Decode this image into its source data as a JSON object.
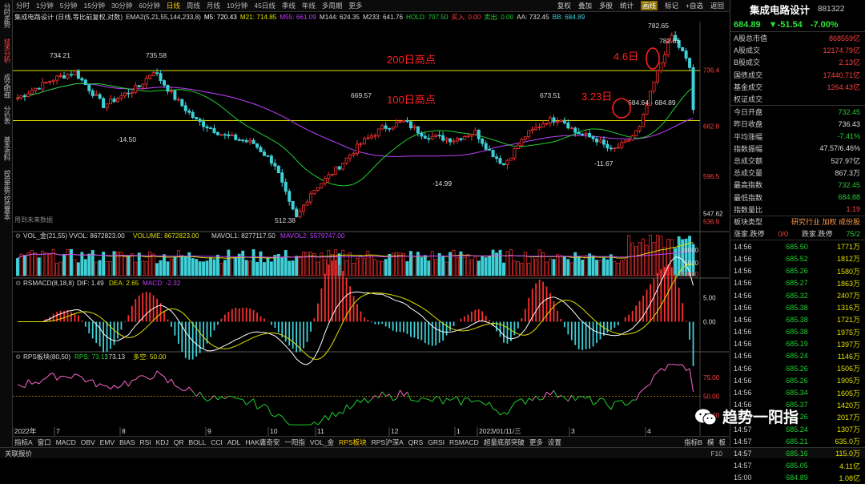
{
  "stock": {
    "name": "集成电路设计",
    "code": "881322",
    "price": "684.89",
    "change": "▼-51.54",
    "pct": "-7.00%"
  },
  "period_tabs": [
    "分时",
    "1分钟",
    "5分钟",
    "15分钟",
    "30分钟",
    "60分钟",
    "日线",
    "周线",
    "月线",
    "10分钟",
    "45日线",
    "季线",
    "年线",
    "多周期",
    "更多"
  ],
  "active_period": "日线",
  "right_tools": [
    "复权",
    "叠加",
    "多股",
    "统计",
    "画线",
    "标记",
    "+自选",
    "返回"
  ],
  "left_tabs": [
    "分时走势",
    "技术分析",
    "成交明细",
    "分价表",
    "基本资料",
    "控盘走势",
    "控盘基本"
  ],
  "indicator_line": {
    "name": "集成电路设计 (日线,等比前复权,对数)",
    "ema": "EMA2(5,21,55,144,233,8)",
    "m5": "M5: 720.43",
    "m21": "M21: 714.85",
    "m55": "M55: 661.09",
    "m144": "M144: 624.35",
    "m233": "M233: 641.76",
    "hold": "HOLD: 707.50",
    "buy": "买入: 0.00",
    "sell": "卖出: 0.00",
    "aa": "AA: 732.45",
    "bb": "BB: 684.89"
  },
  "price_labels": {
    "high1": "734.21",
    "high2": "735.58",
    "high3": "669.57",
    "high4": "673.51",
    "high5": "782.65",
    "high6": "782.65",
    "low1": "-14.50",
    "low2": "512.38",
    "low3": "-14.99",
    "low4": "-11.67",
    "range": "684.64 - 684.89"
  },
  "annotations": {
    "line200": "200日高点",
    "line100": "100日高点",
    "d323": "3.23日",
    "d46": "4.6日"
  },
  "axis_main": [
    "736.4",
    "662.8",
    "596.5",
    "547.62",
    "536.9"
  ],
  "future": "用到未来数据",
  "vol": {
    "title": "VOL_金(21,55)",
    "vvol": "VVOL: 8672823.00",
    "volume": "VOLUME: 8672823.00",
    "mavol1": "MAVOL1: 8277117.50",
    "mavol2": "MAVOL2: 5579747.00",
    "axis": [
      "10000",
      "5000",
      "X1000"
    ]
  },
  "macd": {
    "title": "RSMACD(8,18,8)",
    "dif": "DIF: 1.49",
    "dea": "DEA: 2.65",
    "macd": "MACD: -2.32",
    "axis": [
      "5.00",
      "0.00"
    ]
  },
  "rps": {
    "title": "RPS板块(80,50)",
    "v1": "RPS: 73.13",
    "v2": ": 73.13",
    "v3": "多空: 50.00",
    "axis": [
      "75.00",
      "50.00",
      "25.00"
    ]
  },
  "dates": [
    "2022年",
    "7",
    "8",
    "9",
    "10",
    "11",
    "12",
    "1",
    "2023/01/11/三",
    "3",
    "4"
  ],
  "bottom_tabs": [
    "指标A",
    "窗口",
    "MACD",
    "OBV",
    "EMV",
    "BIAS",
    "RSI",
    "KDJ",
    "QR",
    "BOLL",
    "CCI",
    "ADL",
    "HAK庸奇安",
    "一阳指",
    "VOL_金",
    "RPS板块",
    "RPS沪深A",
    "QRS",
    "GRSI",
    "RSMACD",
    "超量底部突破",
    "更多",
    "设置"
  ],
  "active_bottom": "RPS板块",
  "bottom_right": [
    "指标B",
    "模",
    "板"
  ],
  "status": {
    "left": "关联报价",
    "f10": "F10"
  },
  "right_panel": {
    "stats": [
      [
        "A股总市值",
        "868559亿"
      ],
      [
        "A股成交",
        "12174.79亿"
      ],
      [
        "B股成交",
        "2.13亿"
      ],
      [
        "国债成交",
        "17440.71亿"
      ],
      [
        "基金成交",
        "1264.43亿"
      ],
      [
        "权证成交",
        ""
      ]
    ],
    "quote": [
      [
        "今日开盘",
        "732.45",
        "g"
      ],
      [
        "昨日收盘",
        "736.43",
        "w"
      ],
      [
        "平均涨幅",
        "-7.41%",
        "g"
      ],
      [
        "指数振幅",
        "47.57/6.46%",
        "w"
      ],
      [
        "总成交额",
        "527.97亿",
        "w"
      ],
      [
        "总成交量",
        "867.3万",
        "w"
      ],
      [
        "最高指数",
        "732.45",
        "g"
      ],
      [
        "最低指数",
        "684.88",
        "g"
      ],
      [
        "指数量比",
        "1.19",
        "r"
      ]
    ],
    "sector": {
      "label": "板块类型",
      "value": "研究行业 加权 成份股"
    },
    "updown": {
      "l1": "涨家.跌停",
      "v1": "0/0",
      "l2": "跌家.跌停",
      "v2": "75/2"
    },
    "ticks": [
      [
        "14:56",
        "685.50",
        "1771万"
      ],
      [
        "14:56",
        "685.52",
        "1812万"
      ],
      [
        "14:56",
        "685.26",
        "1580万"
      ],
      [
        "14:56",
        "685.27",
        "1863万"
      ],
      [
        "14:56",
        "685.32",
        "2407万"
      ],
      [
        "14:56",
        "685.38",
        "1316万"
      ],
      [
        "14:56",
        "685.38",
        "1721万"
      ],
      [
        "14:56",
        "685.38",
        "1975万"
      ],
      [
        "14:56",
        "685.19",
        "1397万"
      ],
      [
        "14:56",
        "685.24",
        "1146万"
      ],
      [
        "14:56",
        "685.26",
        "1506万"
      ],
      [
        "14:56",
        "685.26",
        "1905万"
      ],
      [
        "14:56",
        "685.34",
        "1605万"
      ],
      [
        "14:56",
        "685.37",
        "1420万"
      ],
      [
        "14:57",
        "685.26",
        "2017万"
      ],
      [
        "14:57",
        "685.24",
        "1307万"
      ],
      [
        "14:57",
        "685.21",
        "635.0万"
      ],
      [
        "14:57",
        "685.16",
        "115.0万"
      ],
      [
        "14:57",
        "685.05",
        "4.11亿"
      ],
      [
        "15:00",
        "684.89",
        "1.08亿"
      ]
    ]
  },
  "watermark": "趋势一阳指",
  "colors": {
    "up": "#ff3030",
    "down": "#3fd0d8",
    "green": "#20d030",
    "yellow": "#e0e000",
    "purple": "#c040ff",
    "pink": "#ff66cc",
    "annot": "#ff2020"
  }
}
